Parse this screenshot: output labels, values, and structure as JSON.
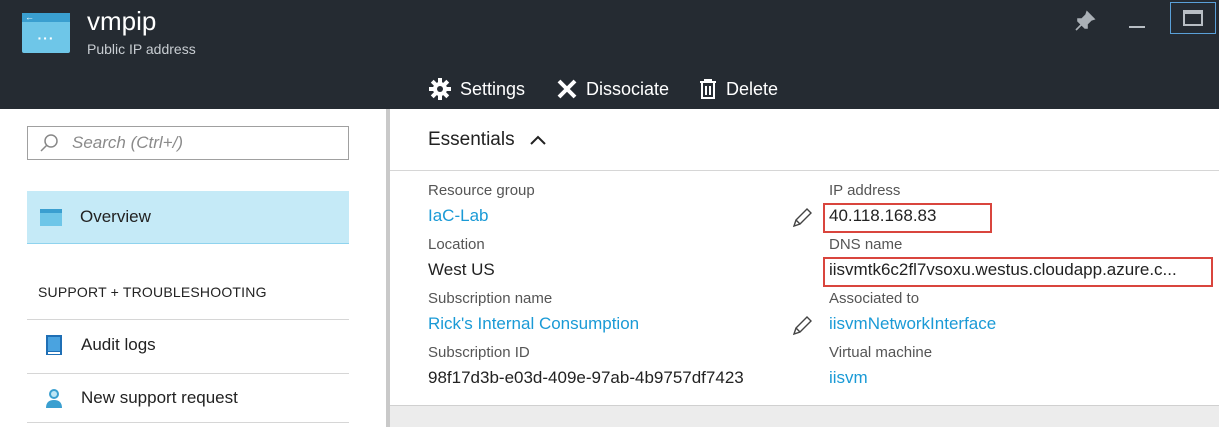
{
  "header": {
    "title": "vmpip",
    "subtitle": "Public IP address",
    "toolbar": {
      "settings_label": "Settings",
      "dissociate_label": "Dissociate",
      "delete_label": "Delete"
    },
    "window_controls": [
      "pin-icon",
      "minimize-icon",
      "maximize-icon"
    ]
  },
  "sidebar": {
    "search": {
      "placeholder": "Search (Ctrl+/)",
      "value": ""
    },
    "items": [
      {
        "label": "Overview",
        "icon": "public-ip-icon",
        "selected": true
      }
    ],
    "section_heading": "SUPPORT + TROUBLESHOOTING",
    "support_items": [
      {
        "label": "Audit logs",
        "icon": "audit-log-icon"
      },
      {
        "label": "New support request",
        "icon": "support-person-icon"
      }
    ]
  },
  "essentials": {
    "heading": "Essentials",
    "left": [
      {
        "label": "Resource group",
        "value": "IaC-Lab",
        "link": true,
        "editable": true
      },
      {
        "label": "Location",
        "value": "West US",
        "link": false
      },
      {
        "label": "Subscription name",
        "value": "Rick's Internal Consumption",
        "link": true,
        "editable": true
      },
      {
        "label": "Subscription ID",
        "value": "98f17d3b-e03d-409e-97ab-4b9757df7423",
        "link": false
      }
    ],
    "right": [
      {
        "label": "IP address",
        "value": "40.118.168.83",
        "link": false,
        "highlighted": true
      },
      {
        "label": "DNS name",
        "value": "iisvmtk6c2fl7vsoxu.westus.cloudapp.azure.c...",
        "link": false,
        "highlighted": true
      },
      {
        "label": "Associated to",
        "value": "iisvmNetworkInterface",
        "link": true
      },
      {
        "label": "Virtual machine",
        "value": "iisvm",
        "link": true
      }
    ]
  },
  "colors": {
    "header_bg": "#252b32",
    "link": "#1a9ad6",
    "selected_bg": "#c5eaf7",
    "highlight_box": "#d9453d"
  }
}
